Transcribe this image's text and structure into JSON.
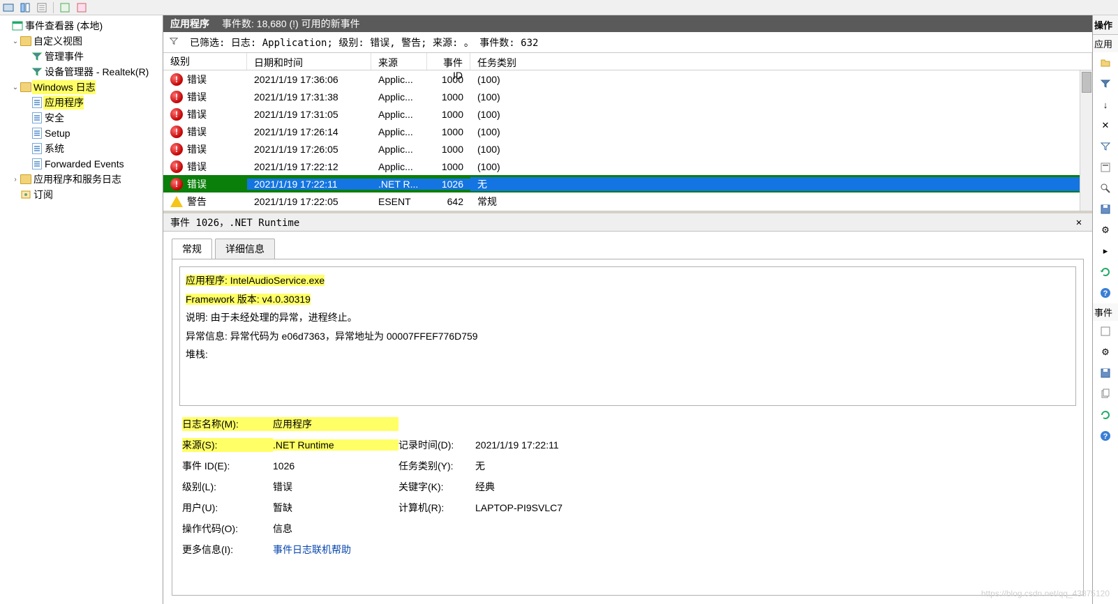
{
  "tree": {
    "root": "事件查看器 (本地)",
    "custom_views": "自定义视图",
    "admin_events": "管理事件",
    "device_mgr": "设备管理器 - Realtek(R)",
    "windows_logs": "Windows 日志",
    "app": "应用程序",
    "security": "安全",
    "setup": "Setup",
    "system": "系统",
    "forwarded": "Forwarded Events",
    "apps_services": "应用程序和服务日志",
    "subscriptions": "订阅"
  },
  "header": {
    "title": "应用程序",
    "count_label": "事件数: 18,680 (!) 可用的新事件"
  },
  "filter": {
    "filtered_label": "已筛选:",
    "log_k": "日志:",
    "log_v": "Application;",
    "level_k": "级别:",
    "level_v": "错误, 警告;",
    "source_k": "来源:",
    "source_v": "。",
    "cnt_k": "事件数:",
    "cnt_v": "632"
  },
  "cols": {
    "level": "级别",
    "datetime": "日期和时间",
    "source": "来源",
    "id": "事件 ID",
    "cat": "任务类别"
  },
  "levels": {
    "error": "错误",
    "warning": "警告"
  },
  "rows": [
    {
      "lvl": "error",
      "dt": "2021/1/19 17:36:06",
      "src": "Applic...",
      "id": "1000",
      "cat": "(100)"
    },
    {
      "lvl": "error",
      "dt": "2021/1/19 17:31:38",
      "src": "Applic...",
      "id": "1000",
      "cat": "(100)"
    },
    {
      "lvl": "error",
      "dt": "2021/1/19 17:31:05",
      "src": "Applic...",
      "id": "1000",
      "cat": "(100)"
    },
    {
      "lvl": "error",
      "dt": "2021/1/19 17:26:14",
      "src": "Applic...",
      "id": "1000",
      "cat": "(100)"
    },
    {
      "lvl": "error",
      "dt": "2021/1/19 17:26:05",
      "src": "Applic...",
      "id": "1000",
      "cat": "(100)"
    },
    {
      "lvl": "error",
      "dt": "2021/1/19 17:22:12",
      "src": "Applic...",
      "id": "1000",
      "cat": "(100)"
    },
    {
      "lvl": "error",
      "dt": "2021/1/19 17:22:11",
      "src": ".NET R...",
      "id": "1026",
      "cat": "无",
      "sel": true
    },
    {
      "lvl": "warning",
      "dt": "2021/1/19 17:22:05",
      "src": "ESENT",
      "id": "642",
      "cat": "常规"
    }
  ],
  "detail": {
    "title": "事件 1026，.NET Runtime",
    "tab_general": "常规",
    "tab_details": "详细信息",
    "desc": {
      "l1": "应用程序: IntelAudioService.exe",
      "l2": "Framework 版本: v4.0.30319",
      "l3": "说明: 由于未经处理的异常，进程终止。",
      "l4": "异常信息: 异常代码为 e06d7363，异常地址为 00007FFEF776D759",
      "l5": "堆栈:"
    },
    "props": {
      "log_k": "日志名称(M):",
      "log_v": "应用程序",
      "src_k": "来源(S):",
      "src_v": ".NET Runtime",
      "rec_k": "记录时间(D):",
      "rec_v": "2021/1/19 17:22:11",
      "eid_k": "事件 ID(E):",
      "eid_v": "1026",
      "cat_k": "任务类别(Y):",
      "cat_v": "无",
      "lvl_k": "级别(L):",
      "lvl_v": "错误",
      "key_k": "关键字(K):",
      "key_v": "经典",
      "usr_k": "用户(U):",
      "usr_v": "暂缺",
      "cmp_k": "计算机(R):",
      "cmp_v": "LAPTOP-PI9SVLC7",
      "op_k": "操作代码(O):",
      "op_v": "信息",
      "more_k": "更多信息(I):",
      "more_v": "事件日志联机帮助"
    }
  },
  "right": {
    "actions": "操作",
    "app_hdr": "应用",
    "evt_hdr": "事件"
  },
  "watermark": "https://blog.csdn.net/qq_43875120"
}
